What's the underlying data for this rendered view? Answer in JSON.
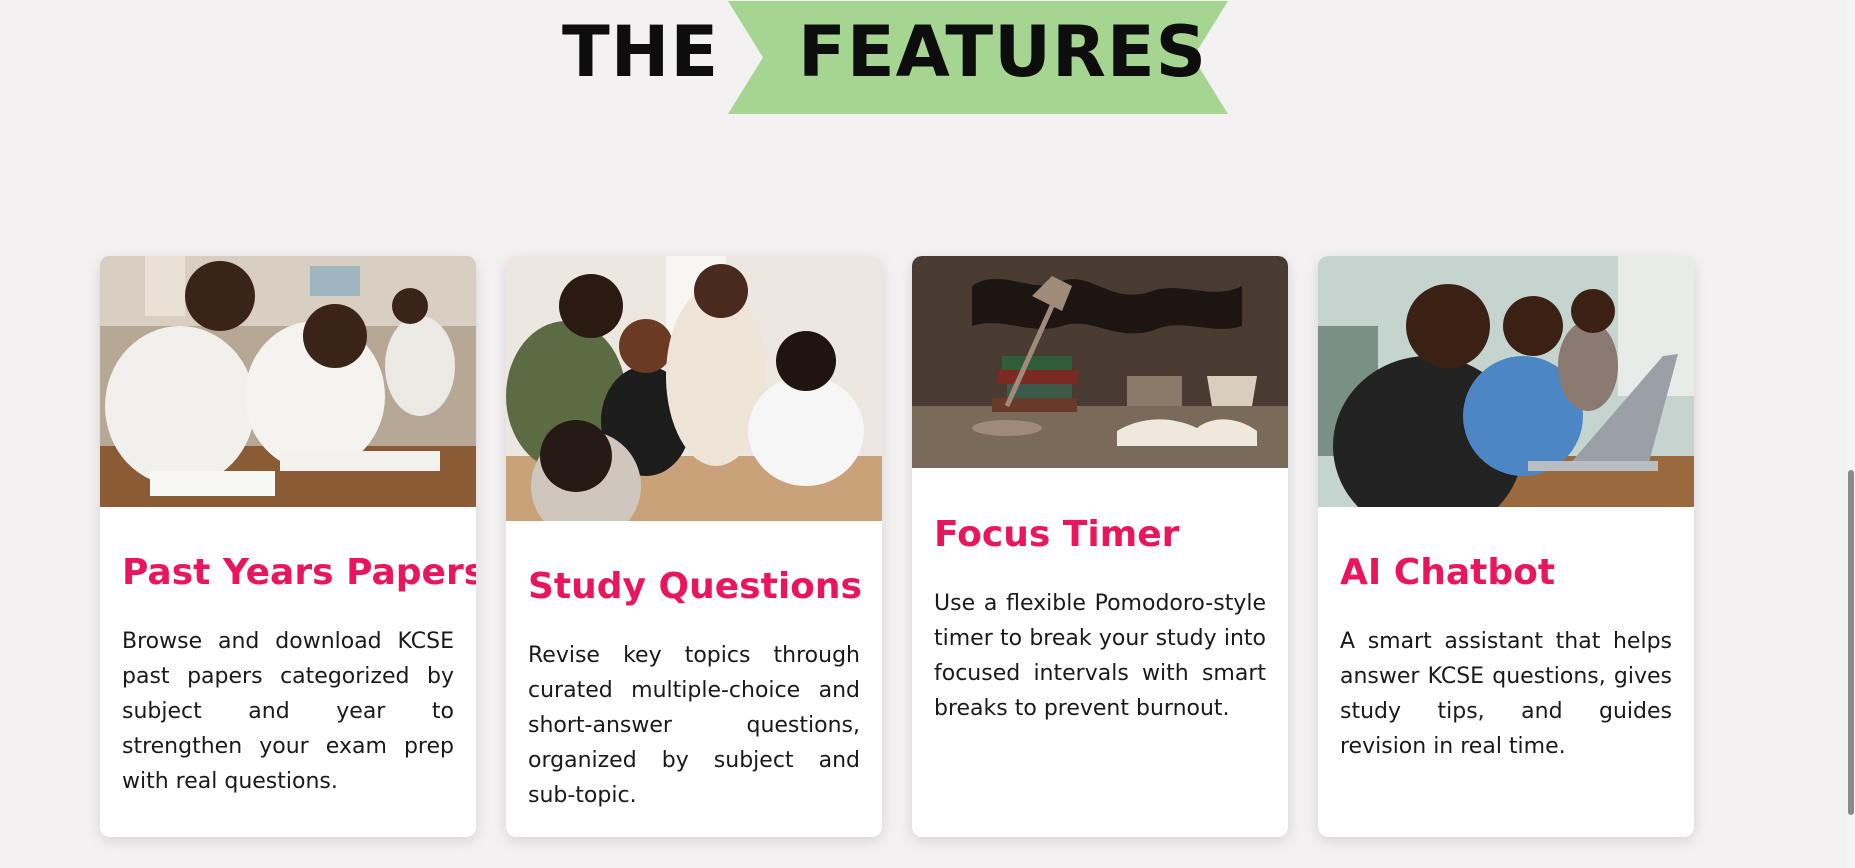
{
  "heading": {
    "word1": "THE",
    "word2": "FEATURES"
  },
  "cards": [
    {
      "title": "Past Years Papers",
      "description": "Browse and download KCSE past papers categorized by subject and year to strengthen your exam prep with real questions."
    },
    {
      "title": "Study Questions",
      "description": "Revise key topics through curated multiple-choice and short-answer questions, organized by subject and sub-topic."
    },
    {
      "title": "Focus Timer",
      "description": "Use a flexible Pomodoro-style timer to break your study into focused intervals with smart breaks to prevent burnout."
    },
    {
      "title": "AI Chatbot",
      "description": "A smart assistant that helps answer KCSE questions, gives study tips, and guides revision in real time."
    }
  ],
  "colors": {
    "accent": "#e9165e",
    "ribbon": "#a6d592",
    "background": "#f3f1f2"
  }
}
